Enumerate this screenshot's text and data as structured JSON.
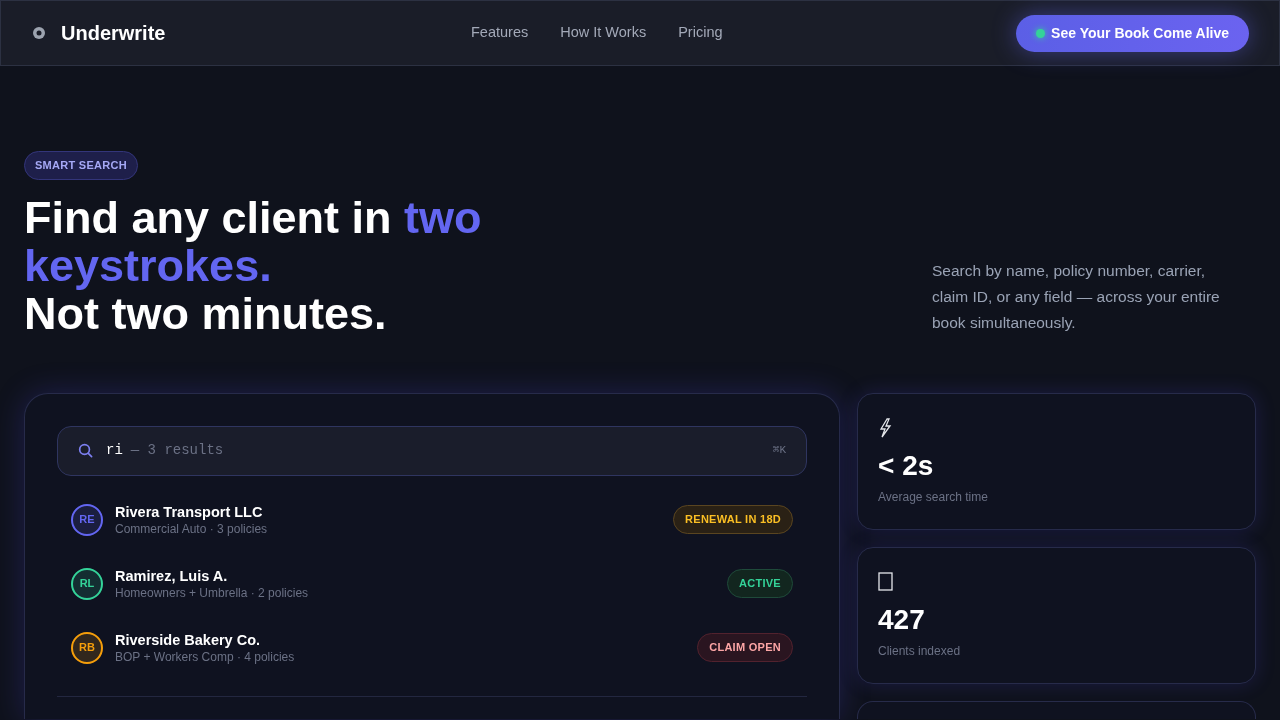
{
  "nav": {
    "brand": "Underwrite",
    "links": [
      "Features",
      "How It Works",
      "Pricing"
    ],
    "cta": "See Your Book Come Alive"
  },
  "hero": {
    "badge": "SMART SEARCH",
    "headline": [
      [
        {
          "text": "Find any client in ",
          "accent": false
        },
        {
          "text": "two keystrokes.",
          "accent": true
        }
      ],
      [
        {
          "text": "Not two minutes.",
          "accent": false
        }
      ]
    ],
    "description": "Search by name, policy number, carrier, claim ID, or any field — across your entire book simultaneously."
  },
  "search": {
    "query": "ri",
    "summary": "— 3 results",
    "shortcut": "⌘K"
  },
  "results": [
    {
      "initials": "RE",
      "color": "#6366f1",
      "name": "Rivera Transport LLC",
      "detail": "Commercial Auto · 3 policies",
      "status": {
        "label": "RENEWAL IN 18D",
        "kind": "warning"
      }
    },
    {
      "initials": "RL",
      "color": "#34d399",
      "name": "Ramirez, Luis A.",
      "detail": "Homeowners + Umbrella · 2 policies",
      "status": {
        "label": "ACTIVE",
        "kind": "success"
      }
    },
    {
      "initials": "RB",
      "color": "#f59e0b",
      "name": "Riverside Bakery Co.",
      "detail": "BOP + Workers Comp · 4 policies",
      "status": {
        "label": "CLAIM OPEN",
        "kind": "danger"
      }
    }
  ],
  "stats": [
    {
      "value": "< 2s",
      "label": "Average search time"
    },
    {
      "value": "427",
      "label": "Clients indexed"
    }
  ]
}
